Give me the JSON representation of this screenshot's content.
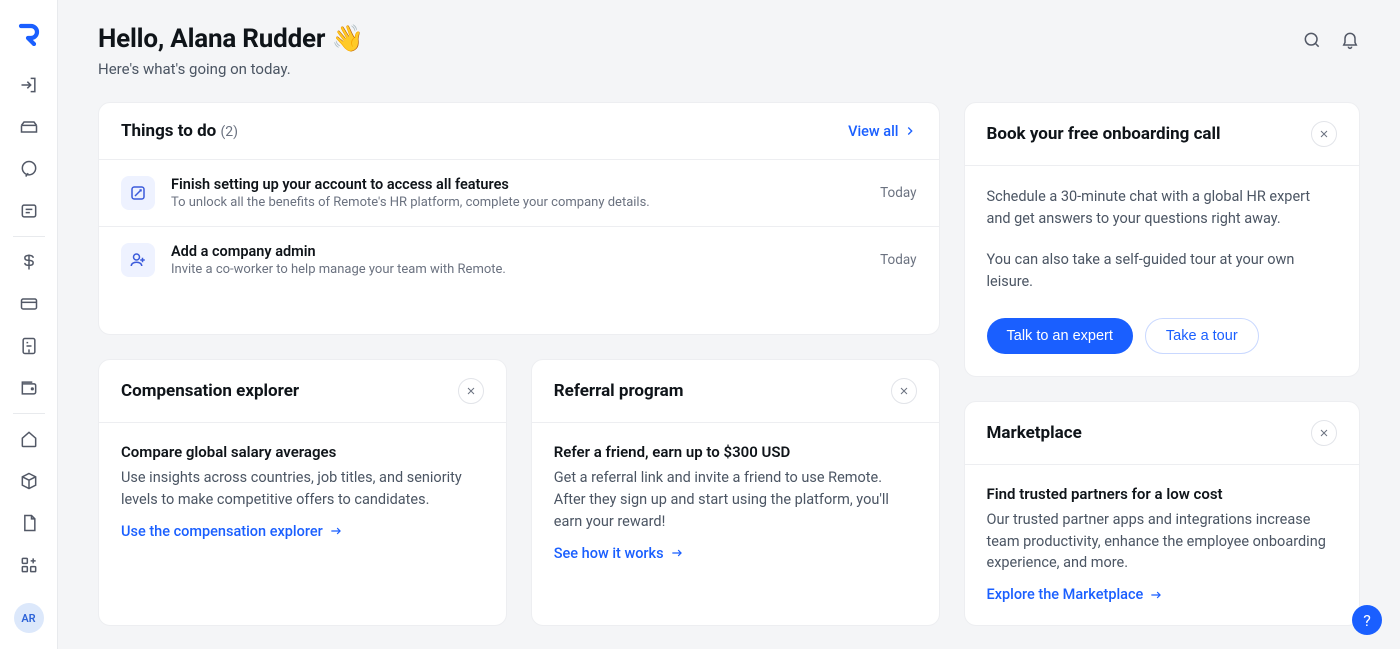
{
  "header": {
    "greeting_prefix": "Hello, ",
    "user_name": "Alana Rudder",
    "wave": "👋",
    "subtitle": "Here's what's going on today."
  },
  "avatar_initials": "AR",
  "things": {
    "title": "Things to do",
    "count": "(2)",
    "view_all": "View all",
    "items": [
      {
        "title": "Finish setting up your account to access all features",
        "desc": "To unlock all the benefits of Remote's HR platform, complete your company details.",
        "date": "Today"
      },
      {
        "title": "Add a company admin",
        "desc": "Invite a co-worker to help manage your team with Remote.",
        "date": "Today"
      }
    ]
  },
  "compensation": {
    "title": "Compensation explorer",
    "heading": "Compare global salary averages",
    "text": "Use insights across countries, job titles, and seniority levels to make competitive offers to candidates.",
    "link": "Use the compensation explorer"
  },
  "referral": {
    "title": "Referral program",
    "heading": "Refer a friend, earn up to $300 USD",
    "text": "Get a referral link and invite a friend to use Remote. After they sign up and start using the platform, you'll earn your reward!",
    "link": "See how it works"
  },
  "onboarding": {
    "title": "Book your free onboarding call",
    "p1": "Schedule a 30-minute chat with a global HR expert and get answers to your questions right away.",
    "p2": "You can also take a self-guided tour at your own leisure.",
    "cta_primary": "Talk to an expert",
    "cta_secondary": "Take a tour"
  },
  "marketplace": {
    "title": "Marketplace",
    "heading": "Find trusted partners for a low cost",
    "text": "Our trusted partner apps and integrations increase team productivity, enhance the employee onboarding experience, and more.",
    "link": "Explore the Marketplace"
  },
  "help_label": "?"
}
